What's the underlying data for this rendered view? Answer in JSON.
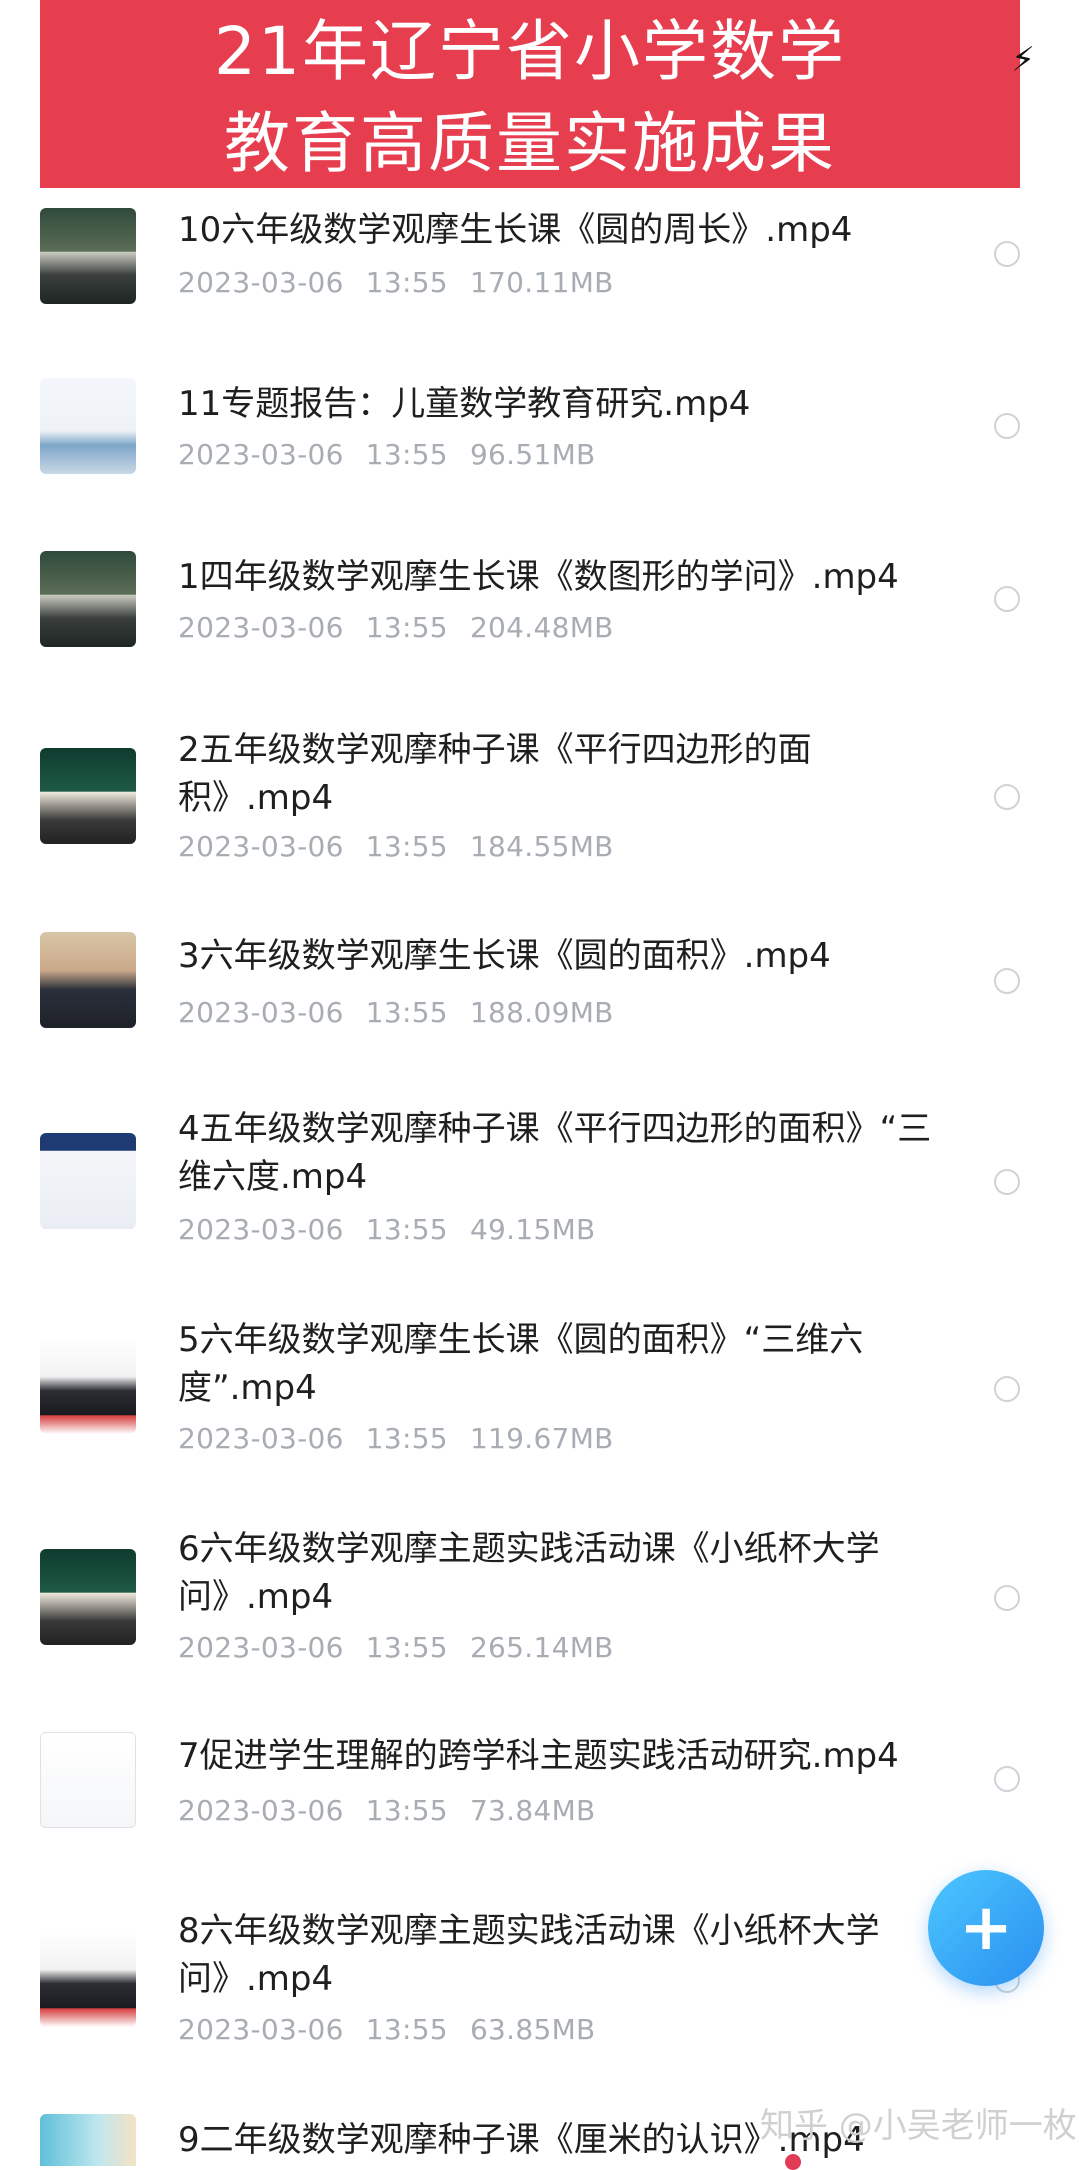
{
  "banner": {
    "line1": "21年辽宁省小学数学",
    "line2": "教育高质量实施成果"
  },
  "status": {
    "icon": "lightning-icon"
  },
  "files": [
    {
      "title": "10六年级数学观摩生长课《圆的周长》.mp4",
      "date": "2023-03-06",
      "time": "13:55",
      "size": "170.11MB",
      "thumb": "classroom"
    },
    {
      "title": "11专题报告：儿童数学教育研究.mp4",
      "date": "2023-03-06",
      "time": "13:55",
      "size": "96.51MB",
      "thumb": "slide"
    },
    {
      "title": "1四年级数学观摩生长课《数图形的学问》.mp4",
      "date": "2023-03-06",
      "time": "13:55",
      "size": "204.48MB",
      "thumb": "classroom"
    },
    {
      "title": "2五年级数学观摩种子课《平行四边形的面积》.mp4",
      "date": "2023-03-06",
      "time": "13:55",
      "size": "184.55MB",
      "thumb": "board"
    },
    {
      "title": "3六年级数学观摩生长课《圆的面积》.mp4",
      "date": "2023-03-06",
      "time": "13:55",
      "size": "188.09MB",
      "thumb": "person"
    },
    {
      "title": "4五年级数学观摩种子课《平行四边形的面积》“三维六度.mp4",
      "date": "2023-03-06",
      "time": "13:55",
      "size": "49.15MB",
      "thumb": "slide2"
    },
    {
      "title": "5六年级数学观摩生长课《圆的面积》“三维六度”.mp4",
      "date": "2023-03-06",
      "time": "13:55",
      "size": "119.67MB",
      "thumb": "podium"
    },
    {
      "title": "6六年级数学观摩主题实践活动课《小纸杯大学问》.mp4",
      "date": "2023-03-06",
      "time": "13:55",
      "size": "265.14MB",
      "thumb": "board"
    },
    {
      "title": "7促进学生理解的跨学科主题实践活动研究.mp4",
      "date": "2023-03-06",
      "time": "13:55",
      "size": "73.84MB",
      "thumb": "slide3"
    },
    {
      "title": "8六年级数学观摩主题实践活动课《小纸杯大学问》.mp4",
      "date": "2023-03-06",
      "time": "13:55",
      "size": "63.85MB",
      "thumb": "podium"
    },
    {
      "title": "9二年级数学观摩种子课《厘米的认识》.mp4",
      "date": "",
      "time": "",
      "size": "",
      "thumb": "partial"
    }
  ],
  "fab": {
    "label": "+",
    "icon": "plus-icon"
  },
  "watermark": "知乎 @小吴老师一枚"
}
